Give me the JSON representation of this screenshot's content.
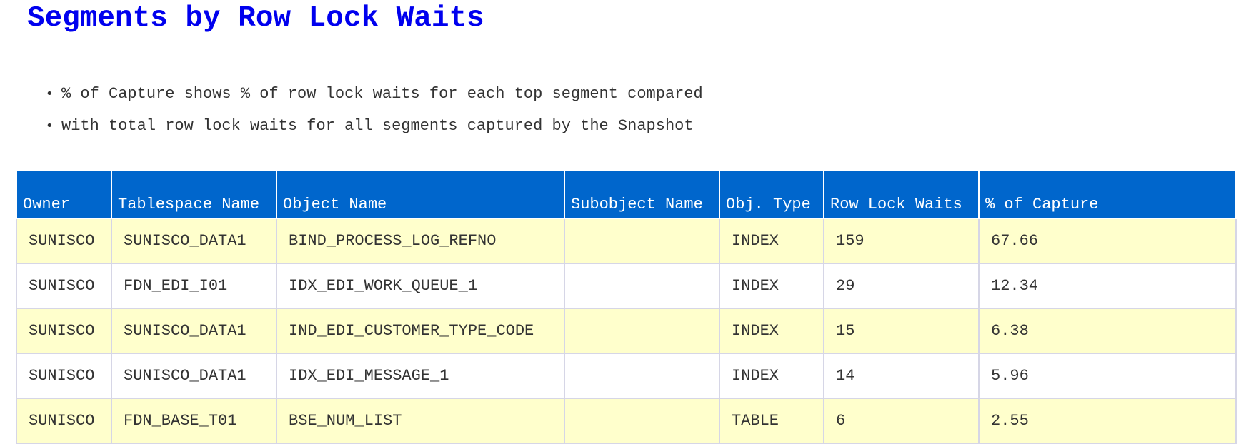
{
  "title": "Segments by Row Lock Waits",
  "notes": [
    "% of Capture shows % of row lock waits for each top segment compared",
    "with total row lock waits for all segments captured by the Snapshot"
  ],
  "table": {
    "headers": [
      "Owner",
      "Tablespace Name",
      "Object Name",
      "Subobject Name",
      "Obj. Type",
      "Row Lock Waits",
      "% of Capture"
    ],
    "rows": [
      [
        "SUNISCO",
        "SUNISCO_DATA1",
        "BIND_PROCESS_LOG_REFNO",
        "",
        "INDEX",
        "159",
        "67.66"
      ],
      [
        "SUNISCO",
        "FDN_EDI_I01",
        "IDX_EDI_WORK_QUEUE_1",
        "",
        "INDEX",
        "29",
        "12.34"
      ],
      [
        "SUNISCO",
        "SUNISCO_DATA1",
        "IND_EDI_CUSTOMER_TYPE_CODE",
        "",
        "INDEX",
        "15",
        "6.38"
      ],
      [
        "SUNISCO",
        "SUNISCO_DATA1",
        "IDX_EDI_MESSAGE_1",
        "",
        "INDEX",
        "14",
        "5.96"
      ],
      [
        "SUNISCO",
        "FDN_BASE_T01",
        "BSE_NUM_LIST",
        "",
        "TABLE",
        "6",
        "2.55"
      ]
    ]
  },
  "colors": {
    "title": "#0000ee",
    "header_bg": "#0066cc",
    "header_text": "#ffffff",
    "odd_row_bg": "#ffffcc",
    "even_row_bg": "#ffffff",
    "text": "#333333"
  }
}
